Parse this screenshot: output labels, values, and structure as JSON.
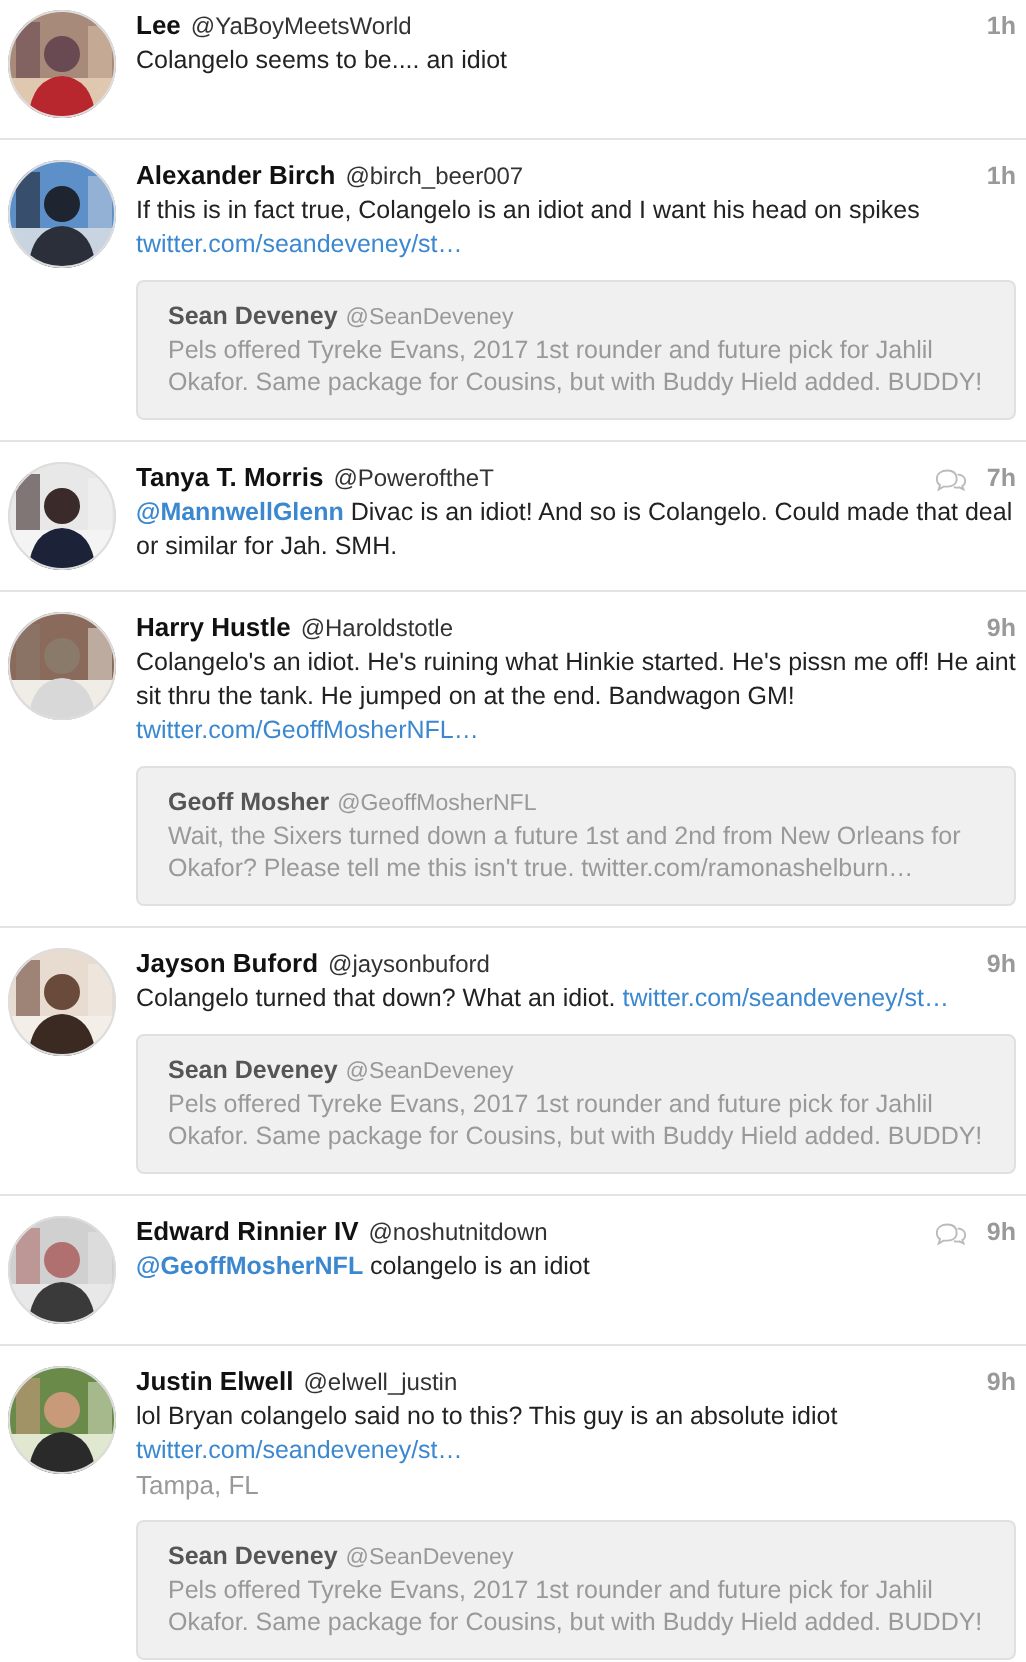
{
  "tweets": [
    {
      "name": "Lee",
      "handle": "@YaBoyMeetsWorld",
      "time": "1h",
      "conversation": false,
      "body": [
        {
          "kind": "text",
          "text": "Colangelo seems to be.... an idiot"
        }
      ]
    },
    {
      "name": "Alexander Birch",
      "handle": "@birch_beer007",
      "time": "1h",
      "conversation": false,
      "body": [
        {
          "kind": "text",
          "text": "If this is in fact true, Colangelo is an idiot and I want his head on spikes "
        },
        {
          "kind": "link",
          "text": "twitter.com/seandeveney/st…"
        }
      ],
      "quote": {
        "name": "Sean Deveney",
        "handle": "@SeanDeveney",
        "text": "Pels offered Tyreke Evans, 2017 1st rounder and future pick for Jahlil Okafor. Same package for Cousins, but with Buddy Hield added. BUDDY!"
      }
    },
    {
      "name": "Tanya T. Morris",
      "handle": "@PoweroftheT",
      "time": "7h",
      "conversation": true,
      "body": [
        {
          "kind": "mention",
          "text": "@MannwellGlenn"
        },
        {
          "kind": "text",
          "text": " Divac is an idiot! And so is Colangelo. Could made that deal or similar for Jah. SMH."
        }
      ]
    },
    {
      "name": "Harry Hustle",
      "handle": "@Haroldstotle",
      "time": "9h",
      "conversation": false,
      "body": [
        {
          "kind": "text",
          "text": "Colangelo's an idiot. He's ruining what Hinkie started. He's pissn me off! He aint sit thru the tank. He jumped on at the end. Bandwagon GM! "
        },
        {
          "kind": "link",
          "text": "twitter.com/GeoffMosherNFL…"
        }
      ],
      "quote": {
        "name": "Geoff Mosher",
        "handle": "@GeoffMosherNFL",
        "text": "Wait, the Sixers turned down a future 1st and 2nd from New Orleans for Okafor? Please tell me this isn't true. twitter.com/ramonashelburn…"
      }
    },
    {
      "name": "Jayson Buford",
      "handle": "@jaysonbuford",
      "time": "9h",
      "conversation": false,
      "body": [
        {
          "kind": "text",
          "text": "Colangelo turned that down? What an idiot. "
        },
        {
          "kind": "link",
          "text": "twitter.com/seandeveney/st…"
        }
      ],
      "quote": {
        "name": "Sean Deveney",
        "handle": "@SeanDeveney",
        "text": "Pels offered Tyreke Evans, 2017 1st rounder and future pick for Jahlil Okafor. Same package for Cousins, but with Buddy Hield added. BUDDY!"
      }
    },
    {
      "name": "Edward Rinnier IV",
      "handle": "@noshutnitdown",
      "time": "9h",
      "conversation": true,
      "body": [
        {
          "kind": "mention",
          "text": "@GeoffMosherNFL"
        },
        {
          "kind": "text",
          "text": " colangelo is an idiot"
        }
      ]
    },
    {
      "name": "Justin Elwell",
      "handle": "@elwell_justin",
      "time": "9h",
      "conversation": false,
      "body": [
        {
          "kind": "text",
          "text": "lol Bryan colangelo said no to this? This guy is an absolute idiot "
        },
        {
          "kind": "link",
          "text": "twitter.com/seandeveney/st…"
        }
      ],
      "location": "Tampa, FL",
      "quote": {
        "name": "Sean Deveney",
        "handle": "@SeanDeveney",
        "text": "Pels offered Tyreke Evans, 2017 1st rounder and future pick for Jahlil Okafor. Same package for Cousins, but with Buddy Hield added. BUDDY!"
      }
    }
  ]
}
